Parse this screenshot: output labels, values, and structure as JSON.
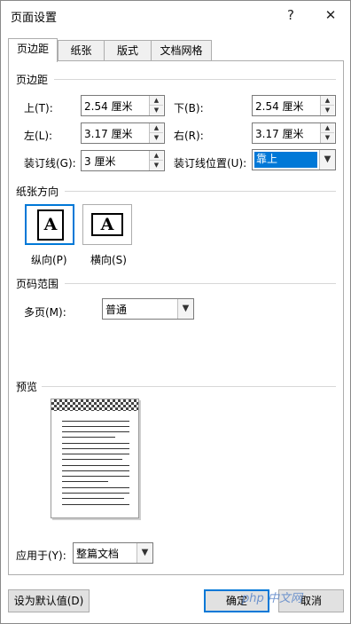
{
  "window": {
    "title": "页面设置",
    "help_icon": "?",
    "close_icon": "✕"
  },
  "tabs": [
    "页边距",
    "纸张",
    "版式",
    "文档网格"
  ],
  "margins": {
    "section_title": "页边距",
    "top_label": "上(T):",
    "top_value": "2.54 厘米",
    "bottom_label": "下(B):",
    "bottom_value": "2.54 厘米",
    "left_label": "左(L):",
    "left_value": "3.17 厘米",
    "right_label": "右(R):",
    "right_value": "3.17 厘米",
    "gutter_label": "装订线(G):",
    "gutter_value": "3 厘米",
    "gutter_pos_label": "装订线位置(U):",
    "gutter_pos_value": "靠上"
  },
  "orientation": {
    "section_title": "纸张方向",
    "portrait_label": "纵向(P)",
    "landscape_label": "横向(S)",
    "icon_letter": "A",
    "selected": "portrait"
  },
  "pages": {
    "section_title": "页码范围",
    "multiple_label": "多页(M):",
    "multiple_value": "普通"
  },
  "preview": {
    "section_title": "预览"
  },
  "apply": {
    "label": "应用于(Y):",
    "value": "整篇文档"
  },
  "buttons": {
    "set_default": "设为默认值(D)",
    "ok": "确定",
    "cancel": "取消"
  },
  "watermark": "php 中文网",
  "colors": {
    "accent": "#0078d7",
    "border": "#adadad"
  }
}
